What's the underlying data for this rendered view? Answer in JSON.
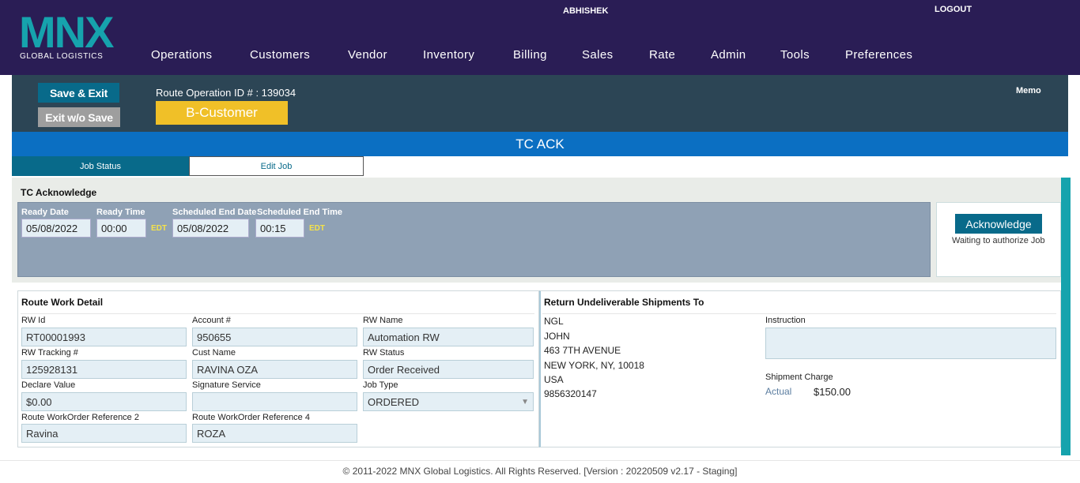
{
  "header": {
    "logo_text": "MNX",
    "logo_tagline": "GLOBAL LOGISTICS",
    "username": "ABHISHEK",
    "logout_label": "LOGOUT",
    "nav": [
      "Operations",
      "Customers",
      "Vendor",
      "Inventory",
      "Billing",
      "Sales",
      "Rate",
      "Admin",
      "Tools",
      "Preferences"
    ]
  },
  "opbar": {
    "save_exit_label": "Save & Exit",
    "exit_nosave_label": "Exit w/o Save",
    "route_operation_id": "Route Operation ID # : 139034",
    "customer_badge": "B-Customer",
    "memo_label": "Memo"
  },
  "status_title": "TC ACK",
  "tabs": {
    "job_status": "Job Status",
    "edit_job": "Edit Job"
  },
  "tc": {
    "title": "TC Acknowledge",
    "ready_date_label": "Ready Date",
    "ready_date": "05/08/2022",
    "ready_time_label": "Ready Time",
    "ready_time": "00:00",
    "tz1": "EDT",
    "sched_end_date_label": "Scheduled End Date",
    "sched_end_date": "05/08/2022",
    "sched_end_time_label": "Scheduled End Time",
    "sched_end_time": "00:15",
    "tz2": "EDT",
    "ack_button": "Acknowledge",
    "ack_note": "Waiting to authorize Job"
  },
  "rw": {
    "title": "Route Work Detail",
    "rw_id_label": "RW Id",
    "rw_id": "RT00001993",
    "account_label": "Account #",
    "account": "950655",
    "rw_name_label": "RW Name",
    "rw_name": "Automation RW",
    "tracking_label": "RW Tracking #",
    "tracking": "125928131",
    "cust_name_label": "Cust Name",
    "cust_name": "RAVINA OZA",
    "rw_status_label": "RW Status",
    "rw_status": "Order Received",
    "declare_label": "Declare Value",
    "declare": "$0.00",
    "signature_label": "Signature Service",
    "signature": "",
    "job_type_label": "Job Type",
    "job_type": "ORDERED",
    "ref2_label": "Route WorkOrder Reference 2",
    "ref2": "Ravina",
    "ref4_label": "Route WorkOrder Reference 4",
    "ref4": "ROZA"
  },
  "return": {
    "title": "Return Undeliverable Shipments To",
    "address_lines": [
      "NGL",
      "JOHN",
      "463 7TH AVENUE",
      "NEW YORK, NY, 10018",
      "USA",
      "9856320147"
    ],
    "instruction_label": "Instruction",
    "instruction": "",
    "shipment_charge_label": "Shipment Charge",
    "actual_label": "Actual",
    "actual_amount": "$150.00"
  },
  "footer": "© 2011-2022 MNX Global Logistics. All Rights Reserved. [Version : 20220509 v2.17 - Staging]",
  "colors": {
    "header_bg": "#2a1d55",
    "logo_teal": "#16a3ad",
    "opbar_bg": "#2c4555",
    "status_blue": "#0b6fc2",
    "accent_teal": "#086a8a",
    "badge_yellow": "#f0c028"
  }
}
